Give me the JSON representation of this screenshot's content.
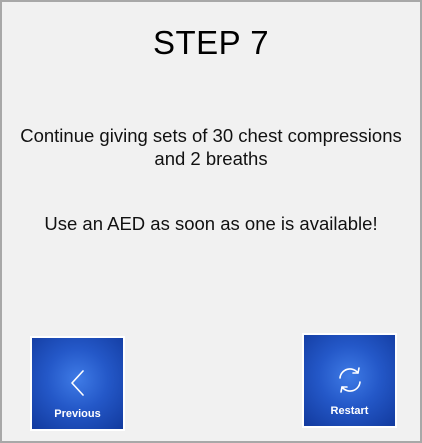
{
  "step": {
    "title": "STEP 7"
  },
  "instructions": [
    "Continue giving sets of 30 chest compressions and 2 breaths",
    "Use an AED as soon as one is available!"
  ],
  "buttons": {
    "previous": {
      "label": "Previous",
      "icon": "chevron-left-icon"
    },
    "restart": {
      "label": "Restart",
      "icon": "refresh-icon"
    }
  },
  "colors": {
    "button_primary": "#2458c8",
    "background": "#f1f1f1",
    "border": "#a8a8a8"
  }
}
